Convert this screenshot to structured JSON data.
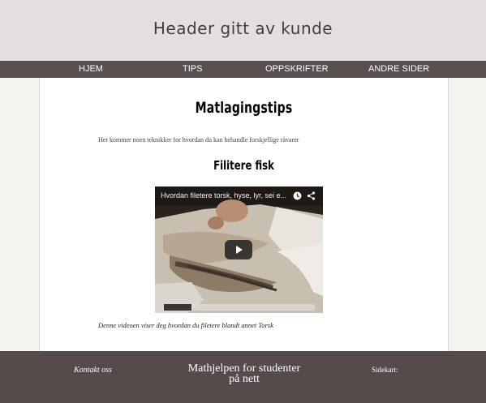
{
  "header": {
    "title": "Header gitt av kunde"
  },
  "nav": {
    "items": [
      {
        "label": "HJEM"
      },
      {
        "label": "TIPS"
      },
      {
        "label": "OPPSKRIFTER"
      },
      {
        "label": "ANDRE SIDER"
      }
    ]
  },
  "main": {
    "title": "Matlagingstips",
    "intro": "Her kommer noen teknikker for hvordan du kan behandle forskjellige råvarer",
    "section_title": "Filitere fisk",
    "video": {
      "title": "Hvordan filetere torsk, hyse, lyr, sei e...",
      "icon_clock": "clock-icon",
      "icon_share": "share-icon",
      "icon_play": "play-icon"
    },
    "caption": "Denne videoen viser deg hvordan du filetere blandt annet Torsk"
  },
  "footer": {
    "contact": "Kontakt oss",
    "center_line1": "Mathjelpen for studenter",
    "center_line2": "på nett",
    "sitemap": "Sidekart:"
  },
  "colors": {
    "header_bg": "#e4dfdf",
    "nav_bg": "#58504e",
    "footer_bg": "#554b4a",
    "side_bg": "#f3f4ee",
    "main_bg": "#ffffff"
  }
}
